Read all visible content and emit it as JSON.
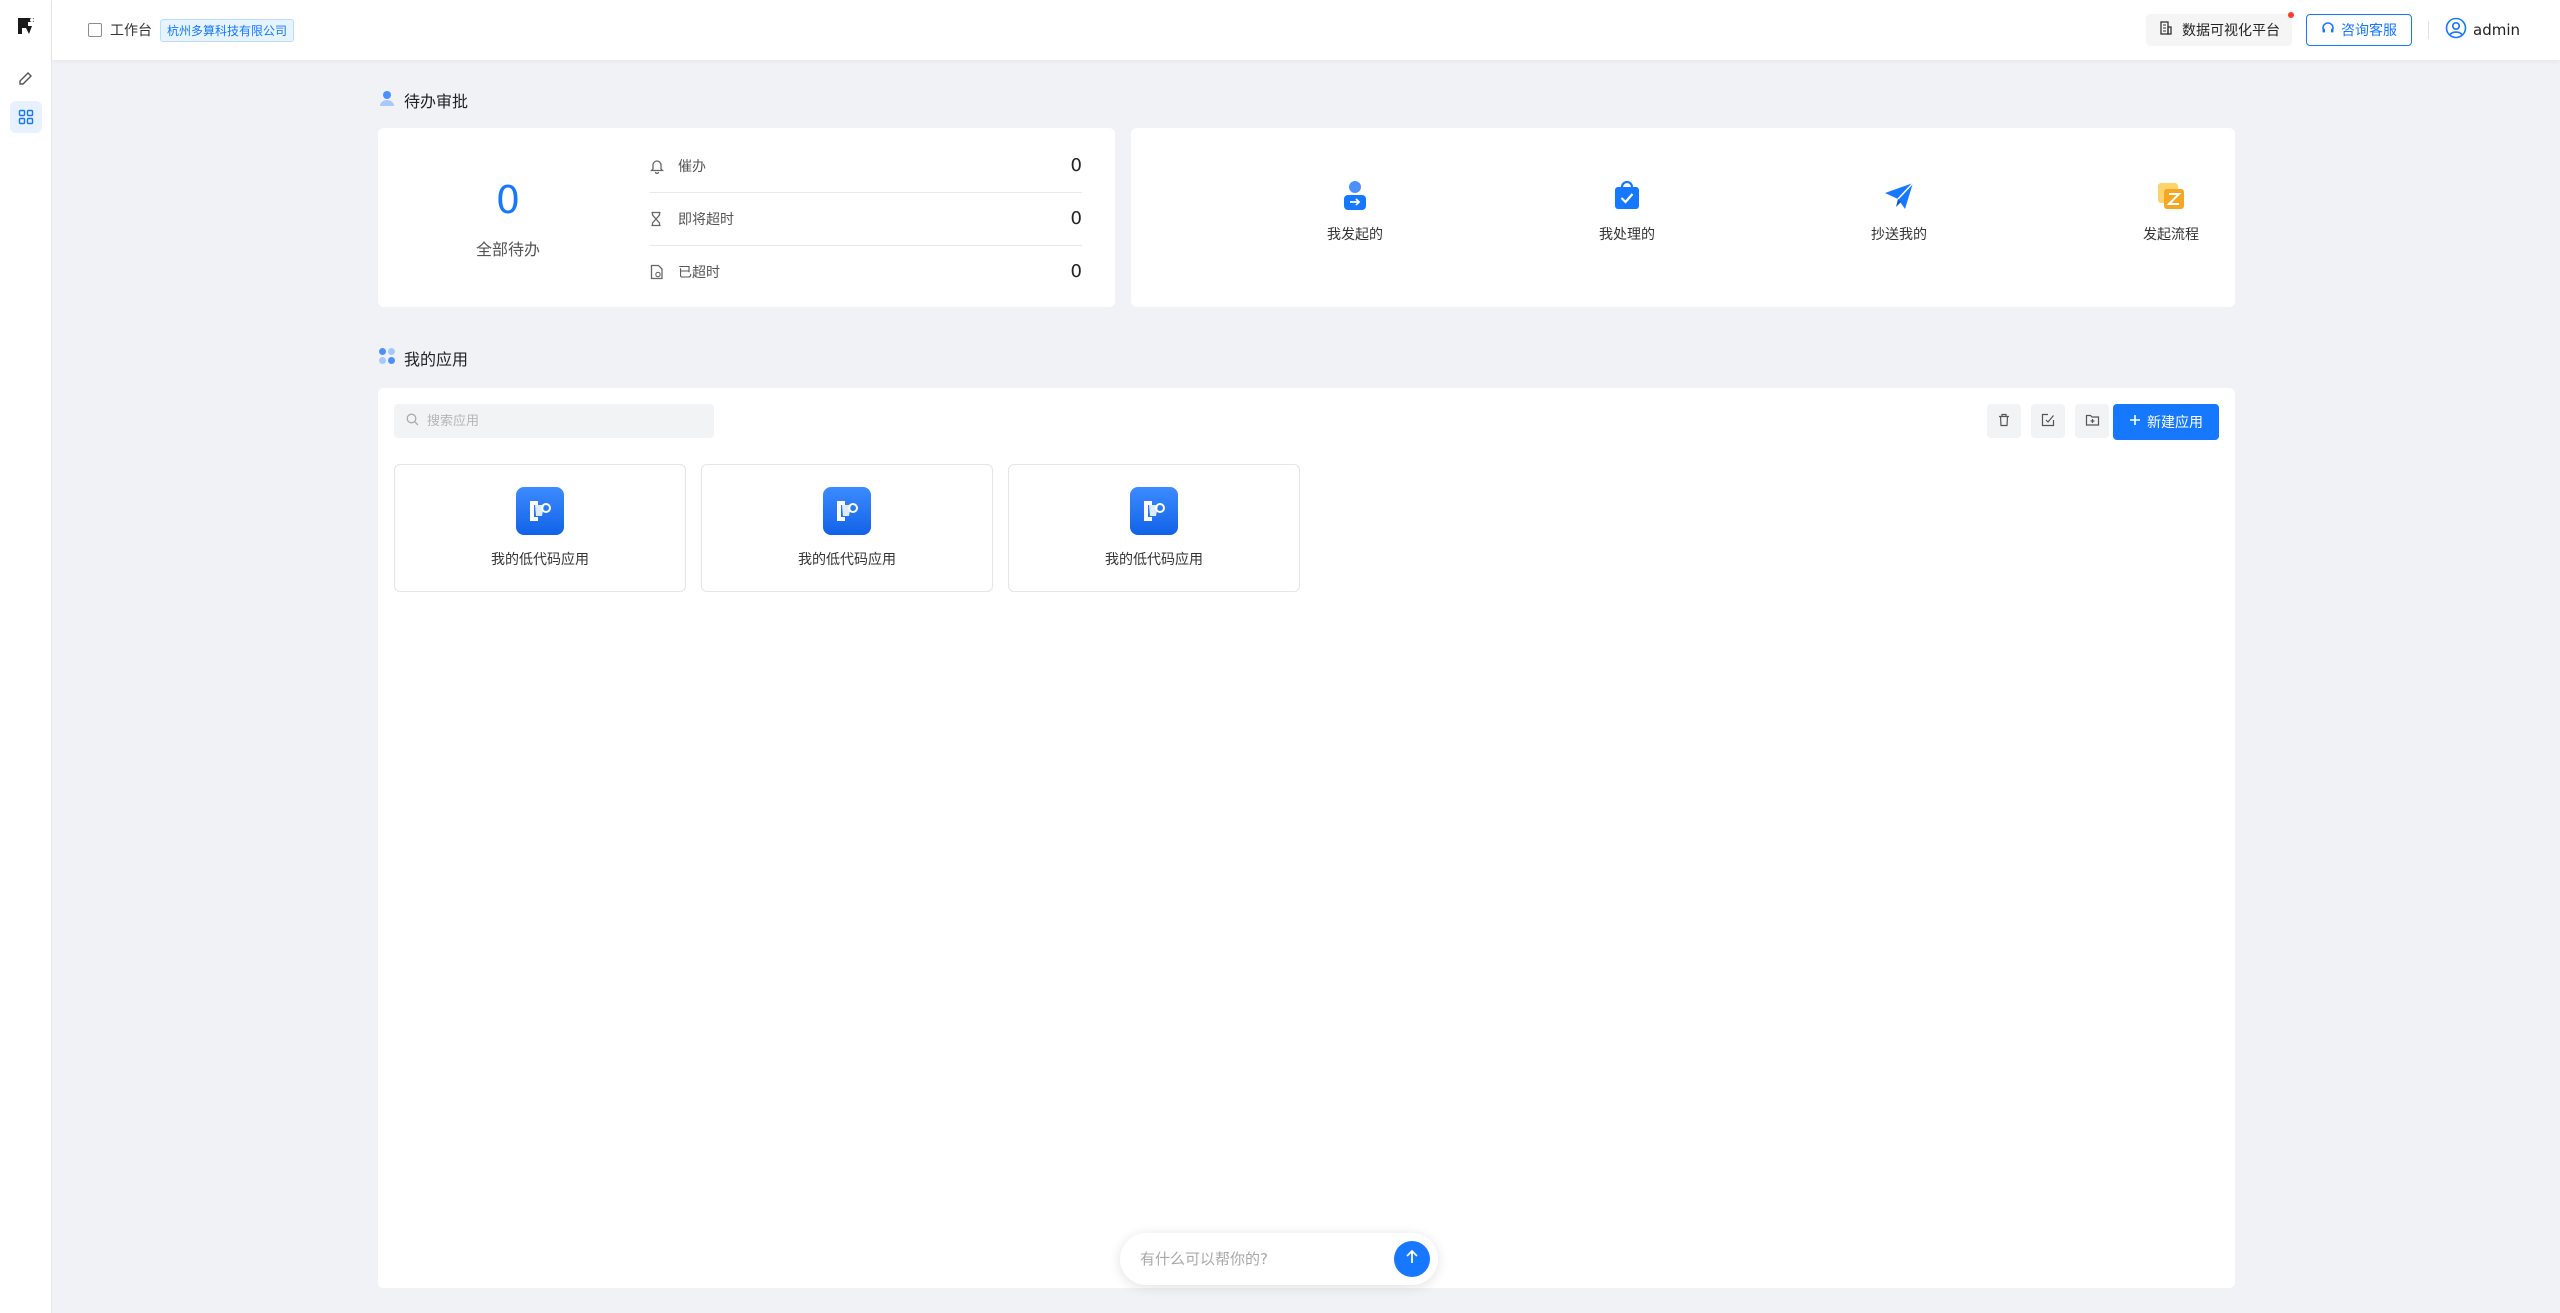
{
  "header": {
    "breadcrumb_label": "工作台",
    "company_tag": "杭州多算科技有限公司",
    "dataviz_label": "数据可视化平台",
    "support_label": "咨询客服",
    "username": "admin"
  },
  "pending": {
    "section_title": "待办审批",
    "total_count": "0",
    "total_label": "全部待办",
    "stats": [
      {
        "label": "催办",
        "value": "0"
      },
      {
        "label": "即将超时",
        "value": "0"
      },
      {
        "label": "已超时",
        "value": "0"
      }
    ],
    "shortcuts": [
      {
        "label": "我发起的",
        "icon": "user-arrow-icon"
      },
      {
        "label": "我处理的",
        "icon": "check-bag-icon"
      },
      {
        "label": "抄送我的",
        "icon": "paper-plane-icon"
      },
      {
        "label": "发起流程",
        "icon": "flow-start-icon"
      }
    ]
  },
  "apps": {
    "section_title": "我的应用",
    "search_placeholder": "搜索应用",
    "new_button_label": "新建应用",
    "items": [
      {
        "name": "我的低代码应用"
      },
      {
        "name": "我的低代码应用"
      },
      {
        "name": "我的低代码应用"
      }
    ]
  },
  "assistant": {
    "placeholder": "有什么可以帮你的?"
  },
  "colors": {
    "accent": "#1677ff",
    "orange": "#f5a623"
  }
}
